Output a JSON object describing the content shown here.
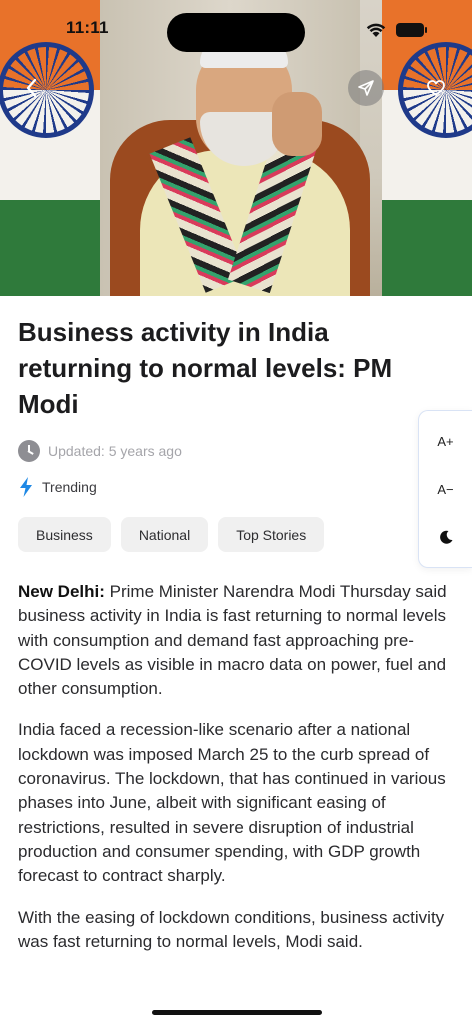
{
  "status_bar": {
    "time": "11:11"
  },
  "article": {
    "title": "Business activity in India returning to normal levels: PM Modi",
    "updated": "Updated: 5 years ago",
    "trending": "Trending",
    "tags": [
      "Business",
      "National",
      "Top Stories"
    ],
    "dateline": "New Delhi:",
    "paragraphs": [
      " Prime Minister Narendra Modi Thursday said business activity in India is fast returning to normal levels with consumption and demand fast approaching pre-COVID levels as visible in macro data on power, fuel and other consumption.",
      "India faced a recession-like scenario after a national lockdown was imposed March 25 to the curb spread of coronavirus. The lockdown, that has continued in various phases into June, albeit with significant easing of restrictions, resulted in severe disruption of industrial production and consumer spending, with GDP growth forecast to contract sharply.",
      "With the easing of lockdown conditions, business activity was fast returning to normal levels, Modi said."
    ]
  },
  "font_panel": {
    "increase": "A+",
    "decrease": "A−"
  },
  "icons": {
    "back": "chevron-left-icon",
    "share": "paper-plane-icon",
    "favorite": "heart-icon",
    "clock": "clock-icon",
    "trending": "lightning-bolt-icon",
    "dark_mode": "moon-icon"
  },
  "colors": {
    "trending_bolt": "#1e88e5",
    "meta_grey": "#a5a5aa",
    "tag_bg": "#f0f0f0"
  }
}
